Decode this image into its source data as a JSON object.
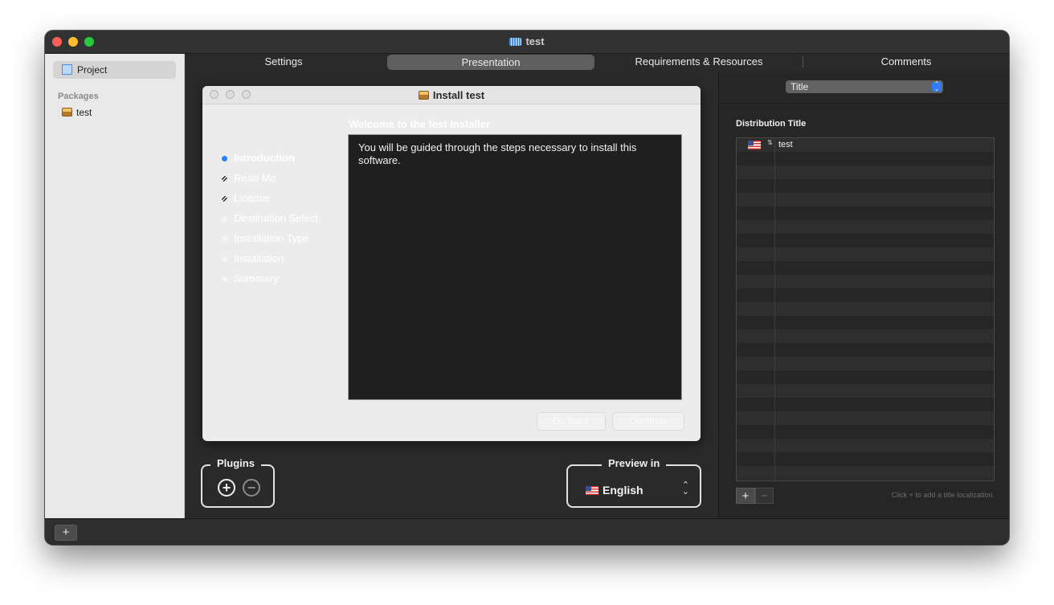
{
  "window": {
    "title": "test",
    "title_icon": "keyboard-icon"
  },
  "sidebar": {
    "project_label": "Project",
    "packages_header": "Packages",
    "packages": [
      {
        "label": "test",
        "icon": "package-box-icon"
      }
    ]
  },
  "tabs": [
    {
      "label": "Settings",
      "active": false
    },
    {
      "label": "Presentation",
      "active": true
    },
    {
      "label": "Requirements & Resources",
      "active": false
    },
    {
      "label": "Comments",
      "active": false
    }
  ],
  "installer": {
    "title": "Install test",
    "welcome": "Welcome to the test Installer",
    "steps": [
      {
        "label": "Introduction",
        "state": "active"
      },
      {
        "label": "Read Me",
        "state": "hatched"
      },
      {
        "label": "License",
        "state": "hatched"
      },
      {
        "label": "Destination Select",
        "state": "pending"
      },
      {
        "label": "Installation Type",
        "state": "pending"
      },
      {
        "label": "Installation",
        "state": "pending"
      },
      {
        "label": "Summary",
        "state": "pending"
      }
    ],
    "body_text": "You will be guided through the steps necessary to install this software.",
    "go_back_label": "Go Back",
    "continue_label": "Continue"
  },
  "plugins": {
    "label": "Plugins",
    "add_icon": "plus-circle-icon",
    "remove_icon": "minus-circle-icon"
  },
  "preview": {
    "label": "Preview in",
    "language": "English"
  },
  "right_panel": {
    "popup_value": "Title",
    "section_title": "Distribution Title",
    "localizations": [
      {
        "language_flag": "us-flag-icon",
        "value": "test"
      }
    ],
    "add_label": "+",
    "remove_label": "−",
    "hint": "Click + to add a title localization."
  },
  "bottom_bar": {
    "add_label": "+"
  },
  "colors": {
    "accent": "#2f7cf6",
    "window_bg": "#2a2a2a",
    "sidebar_bg": "#e9e9e9",
    "close": "#ff5f57",
    "minimize": "#febc2e",
    "zoom": "#28c840"
  }
}
